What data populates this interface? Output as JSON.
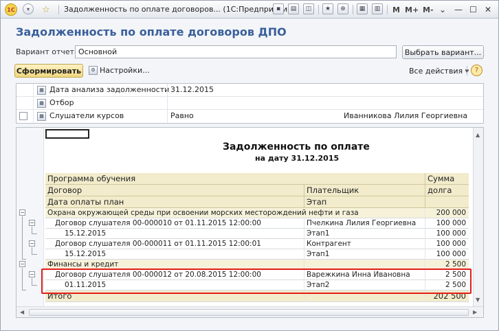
{
  "titlebar": {
    "title": "Задолженность по оплате договоров... (1С:Предприятие)",
    "logo_text": "1С",
    "mem_buttons": [
      "M",
      "M+",
      "M-"
    ]
  },
  "form": {
    "title": "Задолженность по оплате договоров ДПО",
    "variant_label": "Вариант отчета:",
    "variant_value": "Основной",
    "select_variant_button": "Выбрать вариант...",
    "generate_button": "Сформировать",
    "settings_button": "Настройки...",
    "all_actions": "Все действия",
    "help": "?"
  },
  "settings_grid": [
    {
      "name": "Дата анализа задолженности",
      "condition": "",
      "value": "31.12.2015",
      "extra": ""
    },
    {
      "name": "Отбор",
      "condition": "",
      "value": "",
      "extra": ""
    },
    {
      "name": "Слушатели курсов",
      "condition": "Равно",
      "value": "",
      "extra": "Иванникова Лилия Георгиевна"
    }
  ],
  "report": {
    "title": "Задолженность по оплате",
    "subtitle": "на дату 31.12.2015",
    "headers": {
      "program": "Программа обучения",
      "contract": "Договор",
      "payment_date": "Дата оплаты план",
      "payer": "Плательщик",
      "stage": "Этап",
      "sum1": "Сумма",
      "sum2": "долга"
    },
    "rows": [
      {
        "level": 0,
        "text": "Охрана окружающей среды при освоении морских месторождений нефти и газа",
        "col2": "",
        "sum": "200 000"
      },
      {
        "level": 1,
        "text": "Договор слушателя 00-000010 от 01.11.2015 12:00:00",
        "col2": "Пчелкина Лилия Георгиевна",
        "sum": "100 000"
      },
      {
        "level": 2,
        "text": "15.12.2015",
        "col2": "Этап1",
        "sum": "100 000"
      },
      {
        "level": 1,
        "text": "Договор слушателя 00-000011 от 01.11.2015 12:00:01",
        "col2": "Контрагент",
        "sum": "100 000"
      },
      {
        "level": 2,
        "text": "15.12.2015",
        "col2": "Этап1",
        "sum": "100 000"
      },
      {
        "level": 0,
        "text": "Финансы и кредит",
        "col2": "",
        "sum": "2 500"
      },
      {
        "level": 1,
        "text": "Договор слушателя 00-000012 от 20.08.2015 12:00:00",
        "col2": "Варежкина Инна Ивановна",
        "sum": "2 500"
      },
      {
        "level": 2,
        "text": "01.11.2015",
        "col2": "Этап2",
        "sum": "2 500"
      }
    ],
    "total_label": "Итого",
    "total_sum": "202 500"
  }
}
